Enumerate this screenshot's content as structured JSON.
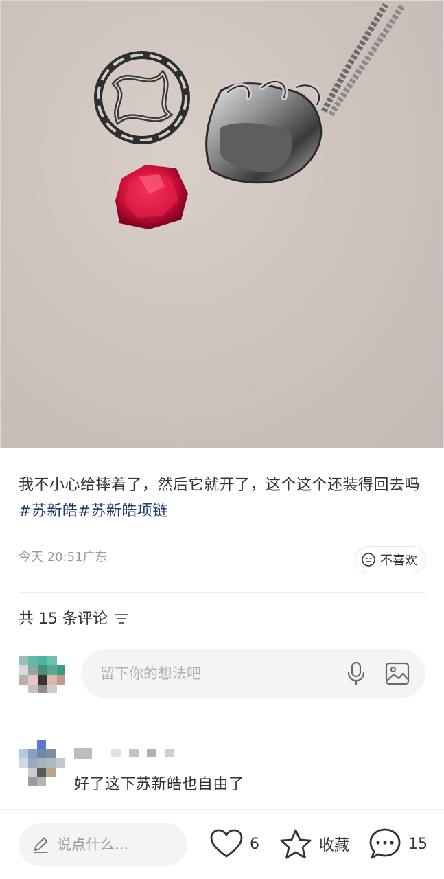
{
  "post": {
    "text": "我不小心给摔着了，然后它就开了，这个这个还装得回去吗",
    "hashtags": [
      "#苏新皓",
      "#苏新皓项链"
    ],
    "time": "今天 20:51",
    "location": "广东",
    "dislike_label": "不喜欢"
  },
  "comments": {
    "header": "共 15 条评论",
    "input_placeholder": "留下你的想法吧",
    "items": [
      {
        "text": "好了这下苏新皓也自由了"
      }
    ]
  },
  "bottom_bar": {
    "input_placeholder": "说点什么...",
    "likes": "6",
    "favorite_label": "收藏",
    "comments_count": "15"
  },
  "icons": {
    "dislike": "neutral-face-icon",
    "sort": "sort-lines-icon",
    "mic": "microphone-icon",
    "image": "image-icon",
    "pencil": "pencil-icon",
    "like": "heart-icon",
    "favorite": "star-icon",
    "comment": "speech-bubble-icon"
  },
  "colors": {
    "hashtag": "#1f3c6b",
    "secondary_text": "#999999",
    "input_bg": "#f4f4f4"
  }
}
